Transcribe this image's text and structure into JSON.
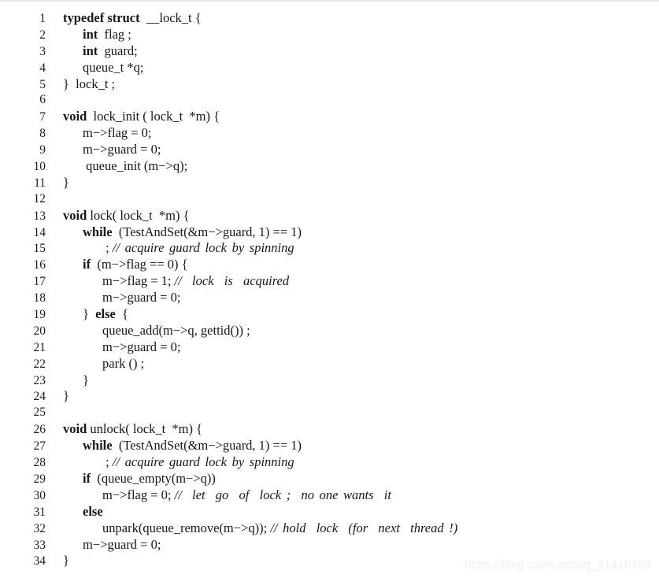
{
  "figure": {
    "kind": "code-listing",
    "language": "C",
    "line_count": 34,
    "watermark": "https://blog.csdn.net/qq_41410799"
  },
  "lines": [
    {
      "n": "1",
      "indent": 0,
      "parts": [
        {
          "t": "typedef struct",
          "s": "kw"
        },
        {
          "t": "  __lock_t {",
          "s": "plain"
        }
      ]
    },
    {
      "n": "2",
      "indent": 1,
      "parts": [
        {
          "t": "int",
          "s": "kw"
        },
        {
          "t": "  flag ;",
          "s": "plain"
        }
      ]
    },
    {
      "n": "3",
      "indent": 1,
      "parts": [
        {
          "t": "int",
          "s": "kw"
        },
        {
          "t": "  guard;",
          "s": "plain"
        }
      ]
    },
    {
      "n": "4",
      "indent": 1,
      "parts": [
        {
          "t": "queue_t *q;",
          "s": "plain"
        }
      ]
    },
    {
      "n": "5",
      "indent": 0,
      "parts": [
        {
          "t": "}  lock_t ;",
          "s": "plain"
        }
      ]
    },
    {
      "n": "6",
      "indent": 0,
      "parts": []
    },
    {
      "n": "7",
      "indent": 0,
      "parts": [
        {
          "t": "void",
          "s": "kw"
        },
        {
          "t": "  lock_init ( lock_t  *m) {",
          "s": "plain"
        }
      ]
    },
    {
      "n": "8",
      "indent": 1,
      "parts": [
        {
          "t": "m−>flag = 0;",
          "s": "plain"
        }
      ]
    },
    {
      "n": "9",
      "indent": 1,
      "parts": [
        {
          "t": "m−>guard = 0;",
          "s": "plain"
        }
      ]
    },
    {
      "n": "10",
      "indent": 1,
      "parts": [
        {
          "t": " queue_init (m−>q);",
          "s": "plain"
        }
      ]
    },
    {
      "n": "11",
      "indent": 0,
      "parts": [
        {
          "t": "}",
          "s": "plain"
        }
      ]
    },
    {
      "n": "12",
      "indent": 0,
      "parts": []
    },
    {
      "n": "13",
      "indent": 0,
      "parts": [
        {
          "t": "void",
          "s": "kw"
        },
        {
          "t": " lock( lock_t  *m) {",
          "s": "plain"
        }
      ]
    },
    {
      "n": "14",
      "indent": 1,
      "parts": [
        {
          "t": "while",
          "s": "kw"
        },
        {
          "t": "  (TestAndSet(&m−>guard, 1) == 1)",
          "s": "plain"
        }
      ]
    },
    {
      "n": "15",
      "indent": 2,
      "parts": [
        {
          "t": " ; ",
          "s": "plain"
        },
        {
          "t": "// acquire guard lock by spinning",
          "s": "cmt"
        }
      ]
    },
    {
      "n": "16",
      "indent": 1,
      "parts": [
        {
          "t": "if",
          "s": "kw"
        },
        {
          "t": "  (m−>flag == 0) {",
          "s": "plain"
        }
      ]
    },
    {
      "n": "17",
      "indent": 2,
      "parts": [
        {
          "t": "m−>flag = 1; ",
          "s": "plain"
        },
        {
          "t": "//  lock  is  acquired",
          "s": "cmt"
        }
      ]
    },
    {
      "n": "18",
      "indent": 2,
      "parts": [
        {
          "t": "m−>guard = 0;",
          "s": "plain"
        }
      ]
    },
    {
      "n": "19",
      "indent": 1,
      "parts": [
        {
          "t": "}  ",
          "s": "plain"
        },
        {
          "t": "else",
          "s": "kw"
        },
        {
          "t": "  {",
          "s": "plain"
        }
      ]
    },
    {
      "n": "20",
      "indent": 2,
      "parts": [
        {
          "t": "queue_add(m−>q, gettid()) ;",
          "s": "plain"
        }
      ]
    },
    {
      "n": "21",
      "indent": 2,
      "parts": [
        {
          "t": "m−>guard = 0;",
          "s": "plain"
        }
      ]
    },
    {
      "n": "22",
      "indent": 2,
      "parts": [
        {
          "t": "park () ;",
          "s": "plain"
        }
      ]
    },
    {
      "n": "23",
      "indent": 1,
      "parts": [
        {
          "t": "}",
          "s": "plain"
        }
      ]
    },
    {
      "n": "24",
      "indent": 0,
      "parts": [
        {
          "t": "}",
          "s": "plain"
        }
      ]
    },
    {
      "n": "25",
      "indent": 0,
      "parts": []
    },
    {
      "n": "26",
      "indent": 0,
      "parts": [
        {
          "t": "void",
          "s": "kw"
        },
        {
          "t": " unlock( lock_t  *m) {",
          "s": "plain"
        }
      ]
    },
    {
      "n": "27",
      "indent": 1,
      "parts": [
        {
          "t": "while",
          "s": "kw"
        },
        {
          "t": "  (TestAndSet(&m−>guard, 1) == 1)",
          "s": "plain"
        }
      ]
    },
    {
      "n": "28",
      "indent": 2,
      "parts": [
        {
          "t": " ; ",
          "s": "plain"
        },
        {
          "t": "// acquire guard lock by spinning",
          "s": "cmt"
        }
      ]
    },
    {
      "n": "29",
      "indent": 1,
      "parts": [
        {
          "t": "if",
          "s": "kw"
        },
        {
          "t": "  (queue_empty(m−>q))",
          "s": "plain"
        }
      ]
    },
    {
      "n": "30",
      "indent": 2,
      "parts": [
        {
          "t": "m−>flag = 0; ",
          "s": "plain"
        },
        {
          "t": "//  let  go  of  lock ;  no one wants  it",
          "s": "cmt"
        }
      ]
    },
    {
      "n": "31",
      "indent": 1,
      "parts": [
        {
          "t": "else",
          "s": "kw"
        }
      ]
    },
    {
      "n": "32",
      "indent": 2,
      "parts": [
        {
          "t": "unpark(queue_remove(m−>q)); ",
          "s": "plain"
        },
        {
          "t": "// hold  lock  (for  next  thread !)",
          "s": "cmt"
        }
      ]
    },
    {
      "n": "33",
      "indent": 1,
      "parts": [
        {
          "t": "m−>guard = 0;",
          "s": "plain"
        }
      ]
    },
    {
      "n": "34",
      "indent": 0,
      "parts": [
        {
          "t": "}",
          "s": "plain"
        }
      ]
    }
  ]
}
